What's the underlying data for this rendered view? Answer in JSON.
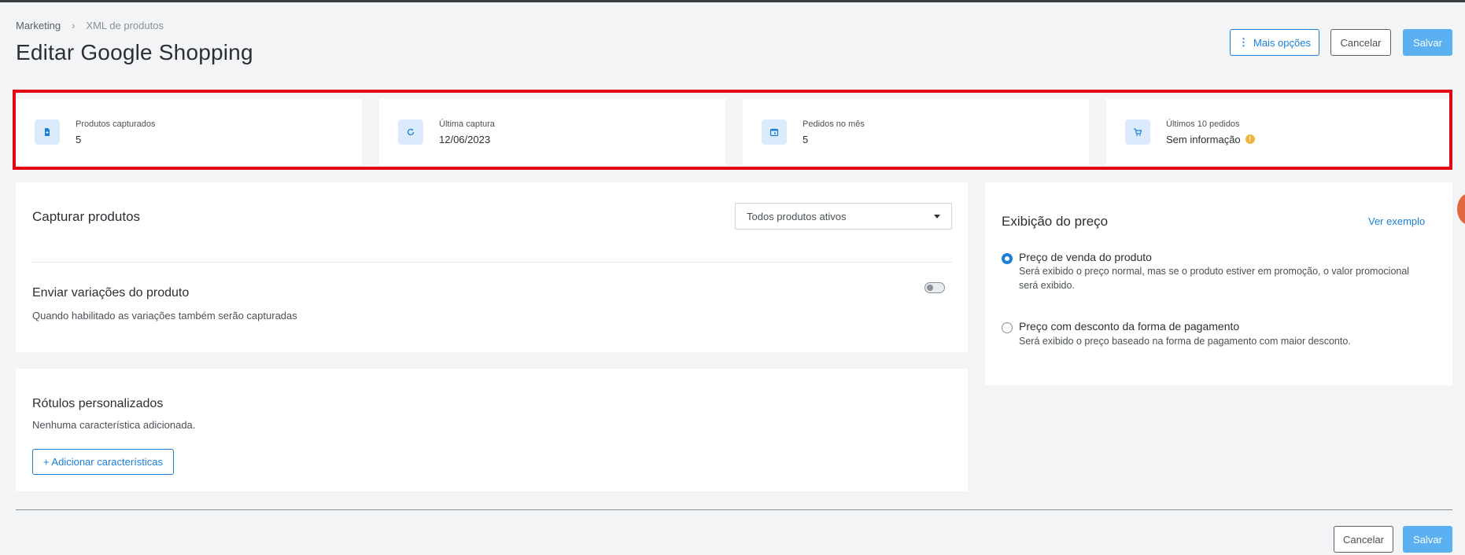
{
  "breadcrumb": {
    "parent": "Marketing",
    "separator": "›",
    "current": "XML de produtos"
  },
  "page_title": "Editar Google Shopping",
  "header_actions": {
    "more_options": "Mais opções",
    "more_icon": "⋮",
    "cancel": "Cancelar",
    "save": "Salvar"
  },
  "stats": [
    {
      "label": "Produtos capturados",
      "value": "5",
      "icon": "document-icon"
    },
    {
      "label": "Última captura",
      "value": "12/06/2023",
      "icon": "refresh-icon"
    },
    {
      "label": "Pedidos no mês",
      "value": "5",
      "icon": "calendar-icon"
    },
    {
      "label": "Últimos 10 pedidos",
      "value": "Sem informação",
      "icon": "cart-icon",
      "info": "!"
    }
  ],
  "capture": {
    "title": "Capturar produtos",
    "select_value": "Todos produtos ativos",
    "variations_title": "Enviar variações do produto",
    "variations_desc": "Quando habilitado as variações também serão capturadas",
    "variations_enabled": false
  },
  "labels": {
    "title": "Rótulos personalizados",
    "empty_text": "Nenhuma característica adicionada.",
    "add_button": "+ Adicionar características"
  },
  "price_display": {
    "title": "Exibição do preço",
    "example_link": "Ver exemplo",
    "options": [
      {
        "title": "Preço de venda do produto",
        "desc": "Será exibido o preço normal, mas se o produto estiver em promoção, o valor promocional será exibido.",
        "selected": true
      },
      {
        "title": "Preço com desconto da forma de pagamento",
        "desc": "Será exibido o preço baseado na forma de pagamento com maior desconto.",
        "selected": false
      }
    ]
  },
  "footer_actions": {
    "cancel": "Cancelar",
    "save": "Salvar"
  },
  "colors": {
    "accent": "#1b7fd8",
    "primary_button": "#5ab0f0",
    "highlight": "#e30613",
    "icon_bg": "#dcebfb",
    "info": "#f0b33a"
  }
}
